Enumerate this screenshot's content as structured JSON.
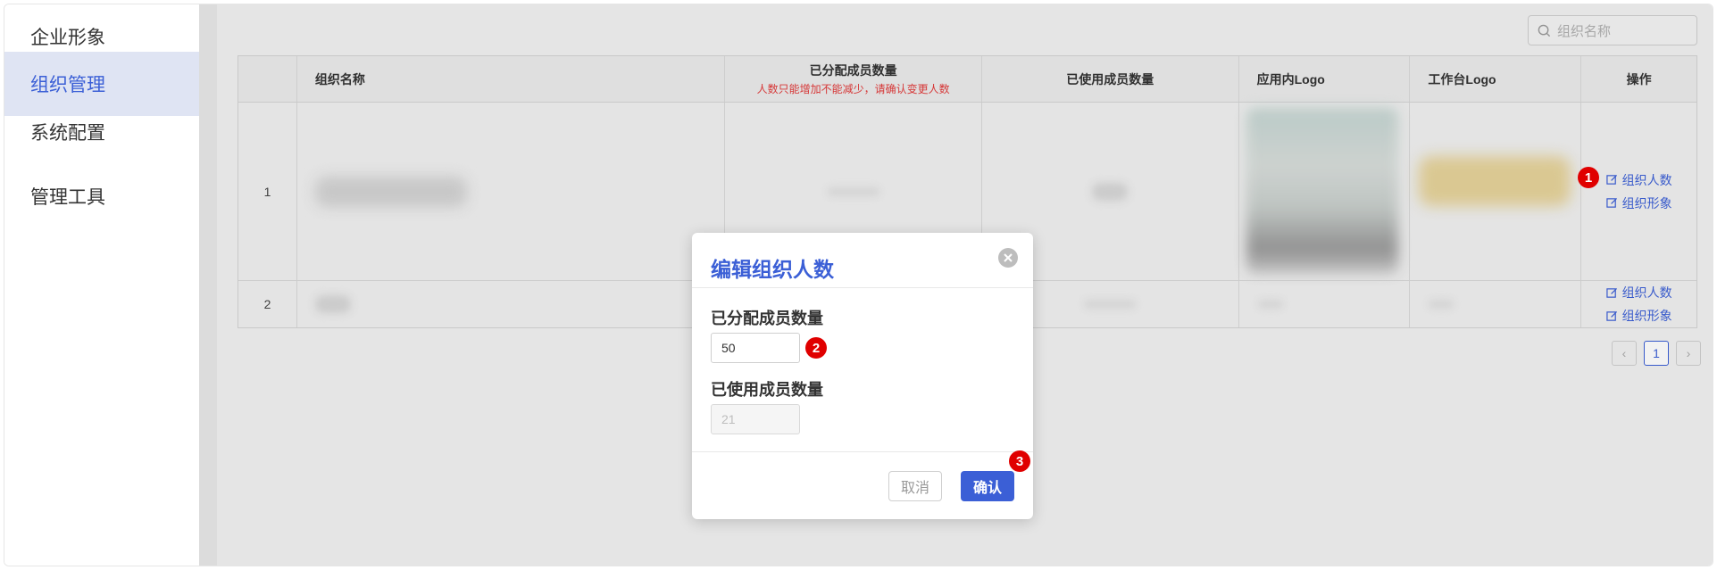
{
  "sidebar": {
    "items": [
      {
        "label": "企业形象"
      },
      {
        "label": "组织管理"
      },
      {
        "label": "系统配置"
      },
      {
        "label": "管理工具"
      }
    ],
    "active_index": 1
  },
  "search": {
    "placeholder": "组织名称"
  },
  "table": {
    "headers": {
      "name": "组织名称",
      "allocated": "已分配成员数量",
      "allocated_note": "人数只能增加不能减少，请确认变更人数",
      "used": "已使用成员数量",
      "app_logo": "应用内Logo",
      "work_logo": "工作台Logo",
      "ops": "操作"
    },
    "rows": [
      {
        "index": "1",
        "op_edit_count": "组织人数",
        "op_edit_image": "组织形象"
      },
      {
        "index": "2",
        "op_edit_count": "组织人数",
        "op_edit_image": "组织形象"
      }
    ]
  },
  "pagination": {
    "prev": "‹",
    "current": "1",
    "next": "›"
  },
  "modal": {
    "title": "编辑组织人数",
    "allocated_label": "已分配成员数量",
    "allocated_value": "50",
    "used_label": "已使用成员数量",
    "used_value": "21",
    "cancel_label": "取消",
    "confirm_label": "确认"
  },
  "badges": {
    "b1": "1",
    "b2": "2",
    "b3": "3"
  },
  "colors": {
    "accent": "#3b5fd6",
    "warning": "#e23b3b",
    "badge": "#e00000"
  }
}
